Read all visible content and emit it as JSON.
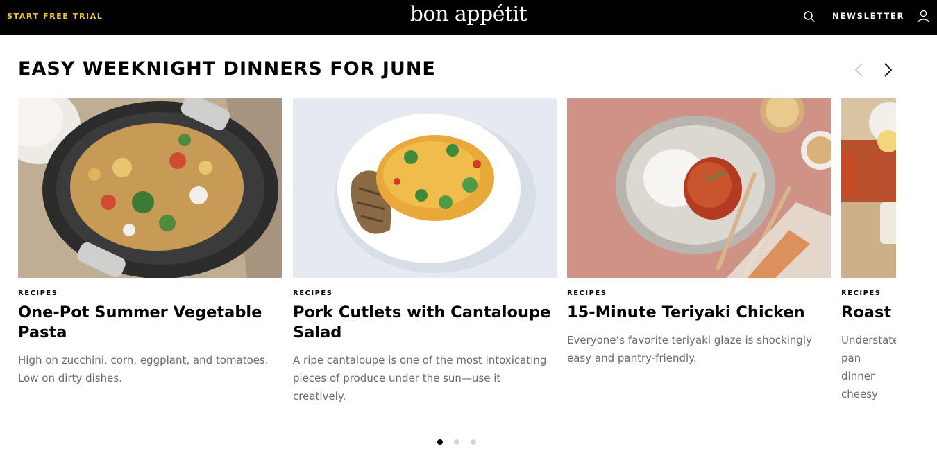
{
  "header": {
    "trial_label": "START FREE TRIAL",
    "logo_text": "bon appétit",
    "newsletter_label": "NEWSLETTER",
    "search_icon": "search-icon",
    "user_icon": "user-icon",
    "accent_color": "#f3c53c"
  },
  "section": {
    "title": "EASY WEEKNIGHT DINNERS FOR JUNE",
    "prev_icon": "chevron-left-icon",
    "next_icon": "chevron-right-icon"
  },
  "cards": [
    {
      "kicker": "RECIPES",
      "title": "One-Pot Summer Vegetable Pasta",
      "description": "High on zucchini, corn, eggplant, and tomatoes. Low on dirty dishes."
    },
    {
      "kicker": "RECIPES",
      "title": "Pork Cutlets with Cantaloupe Salad",
      "description": "A ripe cantaloupe is one of the most intoxicating pieces of produce under the sun—use it creatively."
    },
    {
      "kicker": "RECIPES",
      "title": "15-Minute Teriyaki Chicken",
      "description": "Everyone’s favorite teriyaki glaze is shockingly easy and pantry-friendly."
    },
    {
      "kicker": "RECIPES",
      "title": "Roast C",
      "description": "Understate pan dinner cheesy cho"
    }
  ],
  "pagination": {
    "total_pages": 3,
    "active_page": 1
  }
}
